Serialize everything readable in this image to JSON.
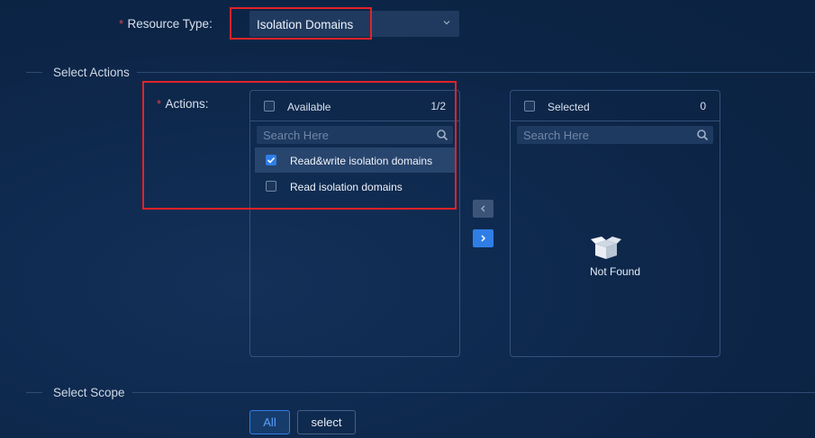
{
  "resource_type": {
    "required_mark": "*",
    "label": "Resource Type:",
    "value": "Isolation Domains"
  },
  "sections": {
    "select_actions": "Select Actions",
    "select_scope": "Select Scope"
  },
  "actions": {
    "required_mark": "*",
    "label": "Actions:"
  },
  "available_panel": {
    "title": "Available",
    "count": "1/2",
    "search_placeholder": "Search Here",
    "items": [
      {
        "label": "Read&write isolation domains",
        "checked": true
      },
      {
        "label": "Read isolation domains",
        "checked": false
      }
    ]
  },
  "selected_panel": {
    "title": "Selected",
    "count": "0",
    "search_placeholder": "Search Here",
    "empty_text": "Not Found"
  },
  "transfer_buttons": {
    "left_icon": "chevron-left-icon",
    "right_icon": "chevron-right-icon"
  },
  "scope": {
    "all_label": "All",
    "select_label": "select"
  },
  "colors": {
    "background": "#0c2445",
    "accent": "#2f7ee6",
    "required": "#e0424a",
    "highlight_box": "#e02328"
  }
}
